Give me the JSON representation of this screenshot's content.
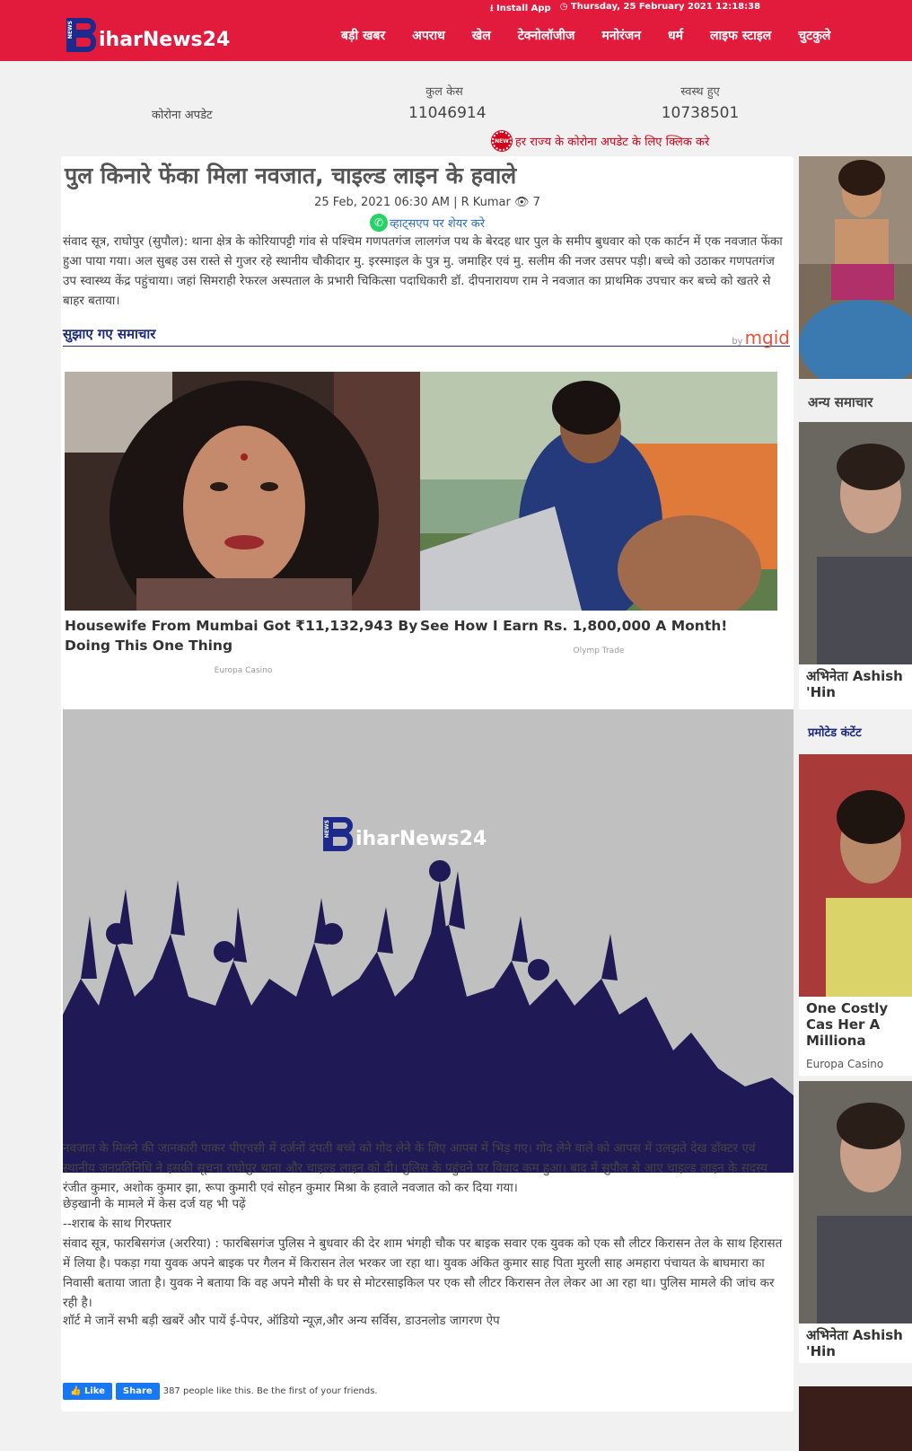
{
  "header": {
    "logo_text": "iharNews24",
    "logo_tag": "NEWS",
    "install_app": "Install App",
    "datetime": "Thursday, 25 February 2021 12:18:38",
    "nav": [
      "बड़ी खबर",
      "अपराध",
      "खेल",
      "टेक्नोलॉजीज",
      "मनोरंजन",
      "धर्म",
      "लाइफ स्टाइल",
      "चुटकुले"
    ]
  },
  "corona": {
    "label": "कोरोना अपडेट",
    "total_label": "कुल केस",
    "total_value": "11046914",
    "recovered_label": "स्वस्थ हुए",
    "recovered_value": "10738501",
    "badge": "NEW",
    "link_text": "हर राज्य के कोरोना अपडेट के लिए क्लिक करे"
  },
  "article": {
    "title": "पुल किनारे फेंका मिला नवजात, चाइल्ड लाइन के हवाले",
    "meta": "25 Feb, 2021 06:30 AM | R Kumar",
    "views": "7",
    "whatsapp": "व्हाट्सएप पर शेयर करे",
    "para1": "संवाद सूत्र, राघोपुर (सुपौल): थाना क्षेत्र के कोरियापट्टी गांव से पश्चिम गणपतगंज लालगंज पथ के बेरदह धार पुल के समीप बुधवार को एक कार्टन में एक नवजात फेंका हुआ पाया गया। अल सुबह उस रास्ते से गुजर रहे स्थानीय चौकीदार मु. इरस्माइल के पुत्र मु. जमाहिर एवं मु. सलीम की नजर उसपर पड़ी। बच्चे को उठाकर गणपतगंज उप स्वास्थ्य केंद्र पहुंचाया। जहां सिमराही रेफरल अस्पताल के प्रभारी चिकित्सा पदाधिकारी डॉ. दीपनारायण राम ने नवजात का प्राथमिक उपचार कर बच्चे को खतरे से बाहर बताया।",
    "suggested_title": "सुझाए गए समाचार",
    "mgid_by": "by",
    "mgid": "mgid",
    "ads": [
      {
        "caption": "Housewife From Mumbai Got ₹11,132,943 By Doing This One Thing",
        "source": "Europa Casino"
      },
      {
        "caption": "See How I Earn Rs. 1,800,000 A Month!",
        "source": "Olymp Trade"
      }
    ],
    "para2": "नवजात के मिलने की जानकारी पाकर पीएचसी में दर्जनों दंपती बच्चे को गोद लेने के लिए आपस में भिड़ गए। गोद लेने वाले को आपस में उलझते देख डॉक्टर एवं स्थानीय जनप्रतिनिधि ने इसकी सूचना राघोपुर थाना और चाइल्ड लाइन को दी। पुलिस के पहुंचने पर विवाद कम हुआ। बाद में सुपौल से आए चाइल्ड लाइन के सदस्य रंजीत कुमार, अशोक कुमार झा, रूपा कुमारी एवं सोहन कुमार मिश्रा के हवाले नवजात को कर दिया गया।",
    "para3": "छेड़खानी के मामले में केस दर्ज यह भी पढ़ें",
    "para4": "--शराब के साथ गिरफ्तार",
    "para5": "संवाद सूत्र, फारबिसगंज (अररिया) : फारबिसगंज पुलिस ने बुधवार की देर शाम भंगही चौक पर बाइक सवार एक युवक को एक सौ लीटर किरासन तेल के साथ हिरासत में लिया है। पकड़ा गया युवक अपने बाइक पर गैलन में किरासन तेल भरकर जा रहा था। युवक अंकित कुमार साह पिता मुरली साह अमहारा पंचायत के बाघमारा का निवासी बताया जाता है। युवक ने बताया कि वह अपने मौसी के घर से मोटरसाइकिल पर एक सौ लीटर किरासन तेल लेकर आ आ रहा था। पुलिस मामले की जांच कर रही है।",
    "para6": "शॉर्ट मे जानें सभी बड़ी खबरें और पायें ई-पेपर, ऑडियो न्यूज़,और अन्य सर्विस, डाउनलोड जागरण ऐप",
    "fb_like": "Like",
    "fb_share": "Share",
    "fb_text": "387 people like this. Be the first of your friends."
  },
  "sidebar": {
    "other_news": "अन्य समाचार",
    "item1": "अभिनेता Ashish 'Hin",
    "promoted": "प्रमोटेड कंटेंट",
    "promo_caption": "One Costly Cas Her A Milliona",
    "promo_source": "Europa Casino",
    "item2": "अभिनेता Ashish 'Hin"
  }
}
